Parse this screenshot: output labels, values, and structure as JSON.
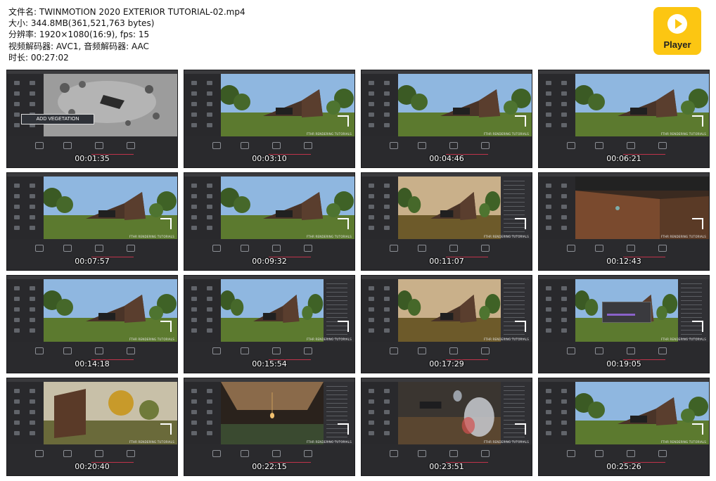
{
  "file_info": {
    "lines": [
      "文件名: TWINMOTION 2020 EXTERIOR TUTORIAL-02.mp4",
      "大小: 344.8MB(361,521,763 bytes)",
      "分辨率: 1920×1080(16:9), fps: 15",
      "视频解码器: AVC1, 音频解码器: AAC",
      "时长: 00:27:02"
    ]
  },
  "player_logo": {
    "label": "Player",
    "color": "#fcc612",
    "icon": "play-icon"
  },
  "overlay_texts": {
    "add_vegetation": "ADD VEGETATION",
    "brand": "FTHR RENDERING TUTORIALS"
  },
  "thumbnails": [
    {
      "time": "00:01:35",
      "scene": "aerial"
    },
    {
      "time": "00:03:10",
      "scene": "house"
    },
    {
      "time": "00:04:46",
      "scene": "house"
    },
    {
      "time": "00:06:21",
      "scene": "house"
    },
    {
      "time": "00:07:57",
      "scene": "house"
    },
    {
      "time": "00:09:32",
      "scene": "house"
    },
    {
      "time": "00:11:07",
      "scene": "sunset"
    },
    {
      "time": "00:12:43",
      "scene": "wall"
    },
    {
      "time": "00:14:18",
      "scene": "house"
    },
    {
      "time": "00:15:54",
      "scene": "house"
    },
    {
      "time": "00:17:29",
      "scene": "sunset"
    },
    {
      "time": "00:19:05",
      "scene": "dialog"
    },
    {
      "time": "00:20:40",
      "scene": "side"
    },
    {
      "time": "00:22:15",
      "scene": "interior"
    },
    {
      "time": "00:23:51",
      "scene": "materials"
    },
    {
      "time": "00:25:26",
      "scene": "full"
    }
  ]
}
